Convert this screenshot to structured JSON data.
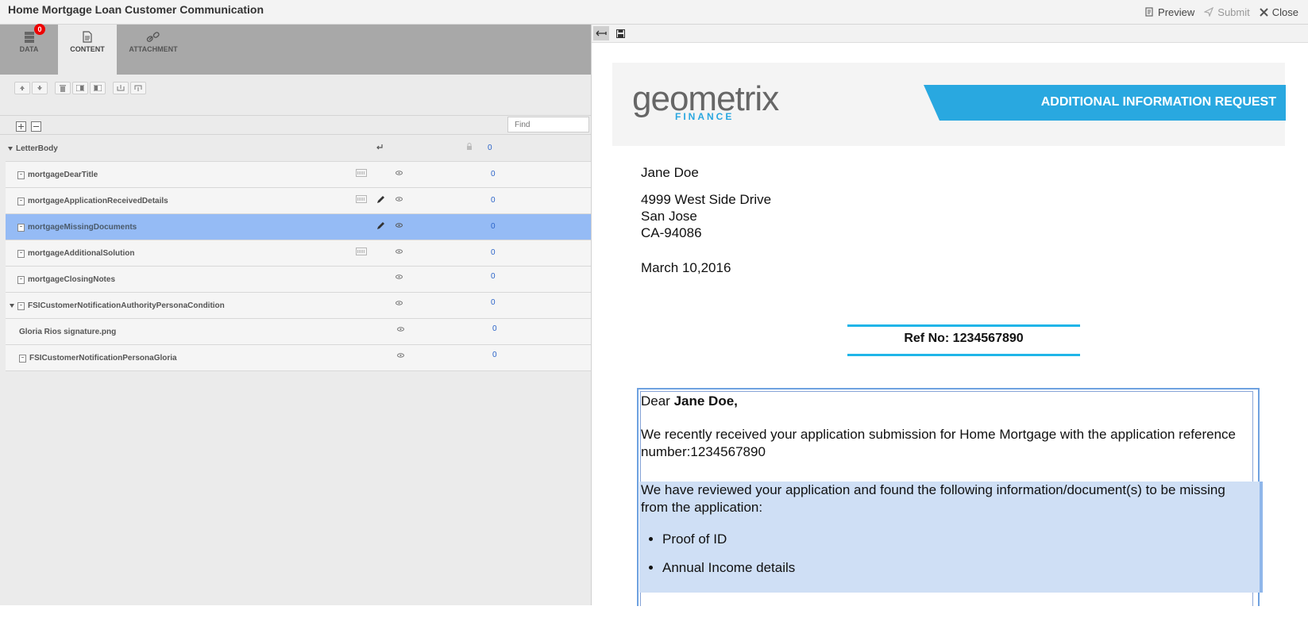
{
  "app": {
    "title": "Home Mortgage Loan Customer Communication"
  },
  "top_actions": {
    "preview": "Preview",
    "submit": "Submit",
    "close": "Close"
  },
  "tabs": [
    {
      "label": "DATA",
      "badge": "0"
    },
    {
      "label": "CONTENT"
    },
    {
      "label": "ATTACHMENT"
    }
  ],
  "find": {
    "placeholder": "Find"
  },
  "tree": [
    {
      "name": "LetterBody",
      "count": "0"
    },
    {
      "name": "mortgageDearTitle",
      "count": "0"
    },
    {
      "name": "mortgageApplicationReceivedDetails",
      "count": "0"
    },
    {
      "name": "mortgageMissingDocuments",
      "count": "0"
    },
    {
      "name": "mortgageAdditionalSolution",
      "count": "0"
    },
    {
      "name": "mortgageClosingNotes",
      "count": "0"
    },
    {
      "name": "FSICustomerNotificationAuthorityPersonaCondition",
      "count": "0"
    },
    {
      "name": "Gloria Rios signature.png",
      "count": "0"
    },
    {
      "name": "FSICustomerNotificationPersonaGloria",
      "count": "0"
    }
  ],
  "letter": {
    "logo_main": "geometrix",
    "logo_sub": "FINANCE",
    "banner": "ADDITIONAL INFORMATION REQUEST",
    "recipient_name": "Jane Doe",
    "address_line1": "4999 West Side Drive",
    "address_line2": "San Jose",
    "address_line3": "CA-94086",
    "date": "March 10,2016",
    "ref": "Ref No: 1234567890",
    "salutation_prefix": "Dear ",
    "salutation_name": "Jane Doe,",
    "received_line1": "We recently received your application submission for Home Mortgage with the application reference",
    "received_line2": "number:1234567890",
    "missing_line1": "We have reviewed your application and found the following information/document(s) to be missing",
    "missing_line2": "from the application:",
    "items": [
      "Proof of ID",
      "Annual Income details"
    ]
  },
  "colors": {
    "accent": "#29a8e0",
    "selected_row": "#95bbf5",
    "badge": "#ee0000"
  }
}
